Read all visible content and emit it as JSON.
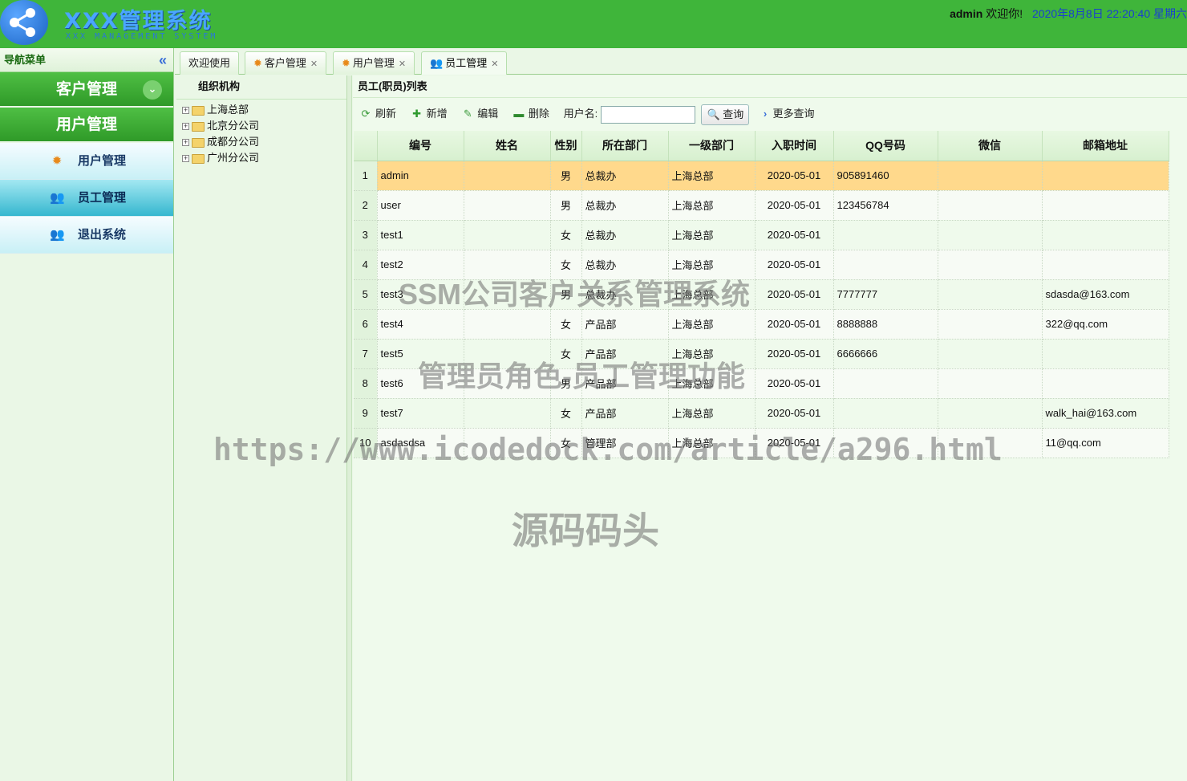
{
  "header": {
    "title": "XXX管理系统",
    "subtitle": "XXX MANAGEMENT SYSTEM",
    "user": "admin",
    "greeting": "欢迎你!",
    "datetime": "2020年8月8日 22:20:40 星期六"
  },
  "nav": {
    "title": "导航菜单",
    "collapse_icon": "«",
    "groups": [
      "客户管理",
      "用户管理"
    ],
    "items": [
      {
        "label": "用户管理",
        "icon": "gear-icon"
      },
      {
        "label": "员工管理",
        "icon": "users-icon"
      },
      {
        "label": "退出系统",
        "icon": "users-icon"
      }
    ]
  },
  "tabs": [
    {
      "label": "欢迎使用"
    },
    {
      "label": "客户管理"
    },
    {
      "label": "用户管理"
    },
    {
      "label": "员工管理"
    }
  ],
  "tree": {
    "title": "组织机构",
    "nodes": [
      "上海总部",
      "北京分公司",
      "成都分公司",
      "广州分公司"
    ]
  },
  "main": {
    "title": "员工(职员)列表",
    "toolbar": {
      "refresh": "刷新",
      "add": "新增",
      "edit": "编辑",
      "delete": "删除",
      "username_label": "用户名:",
      "username_value": "",
      "query": "查询",
      "more": "更多查询"
    },
    "columns": [
      "编号",
      "姓名",
      "性别",
      "所在部门",
      "一级部门",
      "入职时间",
      "QQ号码",
      "微信",
      "邮箱地址"
    ],
    "rows": [
      {
        "n": "1",
        "id": "admin",
        "name": "",
        "sex": "男",
        "dept": "总裁办",
        "top": "上海总部",
        "date": "2020-05-01",
        "qq": "905891460",
        "wx": "",
        "email": ""
      },
      {
        "n": "2",
        "id": "user",
        "name": "",
        "sex": "男",
        "dept": "总裁办",
        "top": "上海总部",
        "date": "2020-05-01",
        "qq": "123456784",
        "wx": "",
        "email": ""
      },
      {
        "n": "3",
        "id": "test1",
        "name": "",
        "sex": "女",
        "dept": "总裁办",
        "top": "上海总部",
        "date": "2020-05-01",
        "qq": "",
        "wx": "",
        "email": ""
      },
      {
        "n": "4",
        "id": "test2",
        "name": "",
        "sex": "女",
        "dept": "总裁办",
        "top": "上海总部",
        "date": "2020-05-01",
        "qq": "",
        "wx": "",
        "email": ""
      },
      {
        "n": "5",
        "id": "test3",
        "name": "",
        "sex": "男",
        "dept": "总裁办",
        "top": "上海总部",
        "date": "2020-05-01",
        "qq": "7777777",
        "wx": "",
        "email": "sdasda@163.com"
      },
      {
        "n": "6",
        "id": "test4",
        "name": "",
        "sex": "女",
        "dept": "产品部",
        "top": "上海总部",
        "date": "2020-05-01",
        "qq": "8888888",
        "wx": "",
        "email": "322@qq.com"
      },
      {
        "n": "7",
        "id": "test5",
        "name": "",
        "sex": "女",
        "dept": "产品部",
        "top": "上海总部",
        "date": "2020-05-01",
        "qq": "6666666",
        "wx": "",
        "email": ""
      },
      {
        "n": "8",
        "id": "test6",
        "name": "",
        "sex": "男",
        "dept": "产品部",
        "top": "上海总部",
        "date": "2020-05-01",
        "qq": "",
        "wx": "",
        "email": ""
      },
      {
        "n": "9",
        "id": "test7",
        "name": "",
        "sex": "女",
        "dept": "产品部",
        "top": "上海总部",
        "date": "2020-05-01",
        "qq": "",
        "wx": "",
        "email": "walk_hai@163.com"
      },
      {
        "n": "10",
        "id": "asdasdsa",
        "name": "",
        "sex": "女",
        "dept": "管理部",
        "top": "上海总部",
        "date": "2020-05-01",
        "qq": "",
        "wx": "",
        "email": "11@qq.com"
      }
    ]
  },
  "watermarks": [
    "SSM公司客户关系管理系统",
    "管理员角色-员工管理功能",
    "https://www.icodedock.com/article/a296.html",
    "源码码头"
  ],
  "colors": {
    "header_green": "#3fb53a",
    "selected_row": "#ffd98c",
    "datetime_blue": "#1a3fd0"
  }
}
